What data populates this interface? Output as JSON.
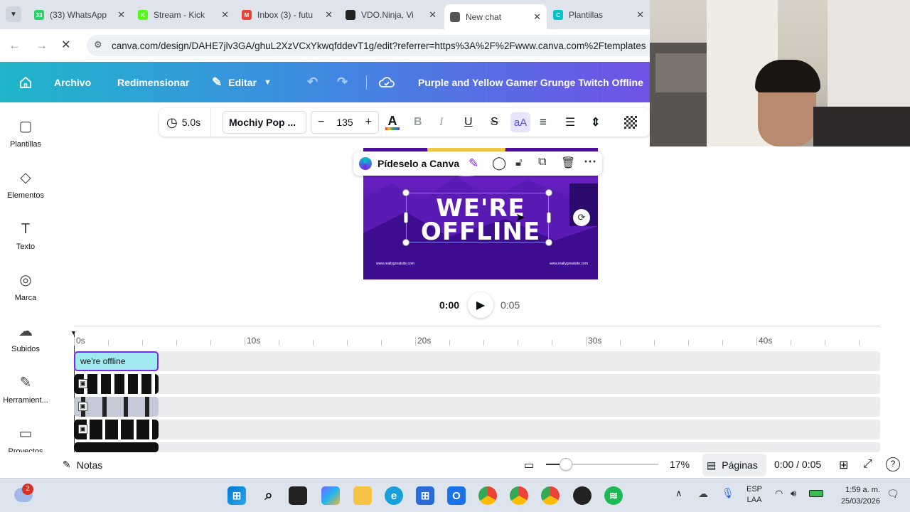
{
  "browser": {
    "tabs": [
      {
        "title": "(33) WhatsApp",
        "badge": "33",
        "color": "#25d366"
      },
      {
        "title": "Stream - Kick",
        "badge": "K",
        "color": "#53fc18"
      },
      {
        "title": "Inbox (3) - futu",
        "badge": "M",
        "color": "#ea4335"
      },
      {
        "title": "VDO.Ninja, Vi",
        "badge": "",
        "color": "#222222"
      },
      {
        "title": "New chat",
        "badge": "",
        "color": "#555555"
      },
      {
        "title": "Plantillas",
        "badge": "C",
        "color": "#00c4cc"
      }
    ],
    "close_glyph": "✕",
    "url": "canva.com/design/DAHE7jlv3GA/ghuL2XzVCxYkwqfddevT1g/edit?referrer=https%3A%2F%2Fwww.canva.com%2Ftemplates"
  },
  "header": {
    "archivo": "Archivo",
    "redimensionar": "Redimensionar",
    "editar": "Editar",
    "design_title": "Purple and Yellow Gamer Grunge Twitch Offline"
  },
  "sidebar": {
    "items": [
      {
        "label": "Plantillas",
        "icon": "template-icon"
      },
      {
        "label": "Elementos",
        "icon": "shapes-icon"
      },
      {
        "label": "Texto",
        "icon": "text-icon"
      },
      {
        "label": "Marca",
        "icon": "brand-icon"
      },
      {
        "label": "Subidos",
        "icon": "upload-icon"
      },
      {
        "label": "Herramient...",
        "icon": "tools-icon"
      },
      {
        "label": "Proyectos",
        "icon": "folder-icon"
      }
    ]
  },
  "toolbar": {
    "duration": "5.0s",
    "font": "Mochiy Pop ...",
    "font_size": "135",
    "case_label": "aA"
  },
  "context_menu": {
    "ask_canva": "Pídeselo a Canva"
  },
  "design": {
    "headline_line1": "WE'RE",
    "headline_line2": "OFFLINE",
    "site_left": "www.reallygreatsite.com",
    "site_right": "www.reallygreatsite.com"
  },
  "playback": {
    "current": "0:00",
    "total": "0:05"
  },
  "timeline": {
    "ticks": [
      "0s",
      "10s",
      "20s",
      "30s",
      "40s"
    ],
    "text_clip": "we're offline"
  },
  "footer": {
    "notes": "Notas",
    "zoom": "17%",
    "pages": "Páginas",
    "time": "0:00 / 0:05",
    "zoom_slider_value": 0.18
  },
  "taskbar": {
    "notification_count": "2",
    "lang1": "ESP",
    "lang2": "LAA",
    "time": "1:59 a. m.",
    "date": "25/03/2026"
  }
}
